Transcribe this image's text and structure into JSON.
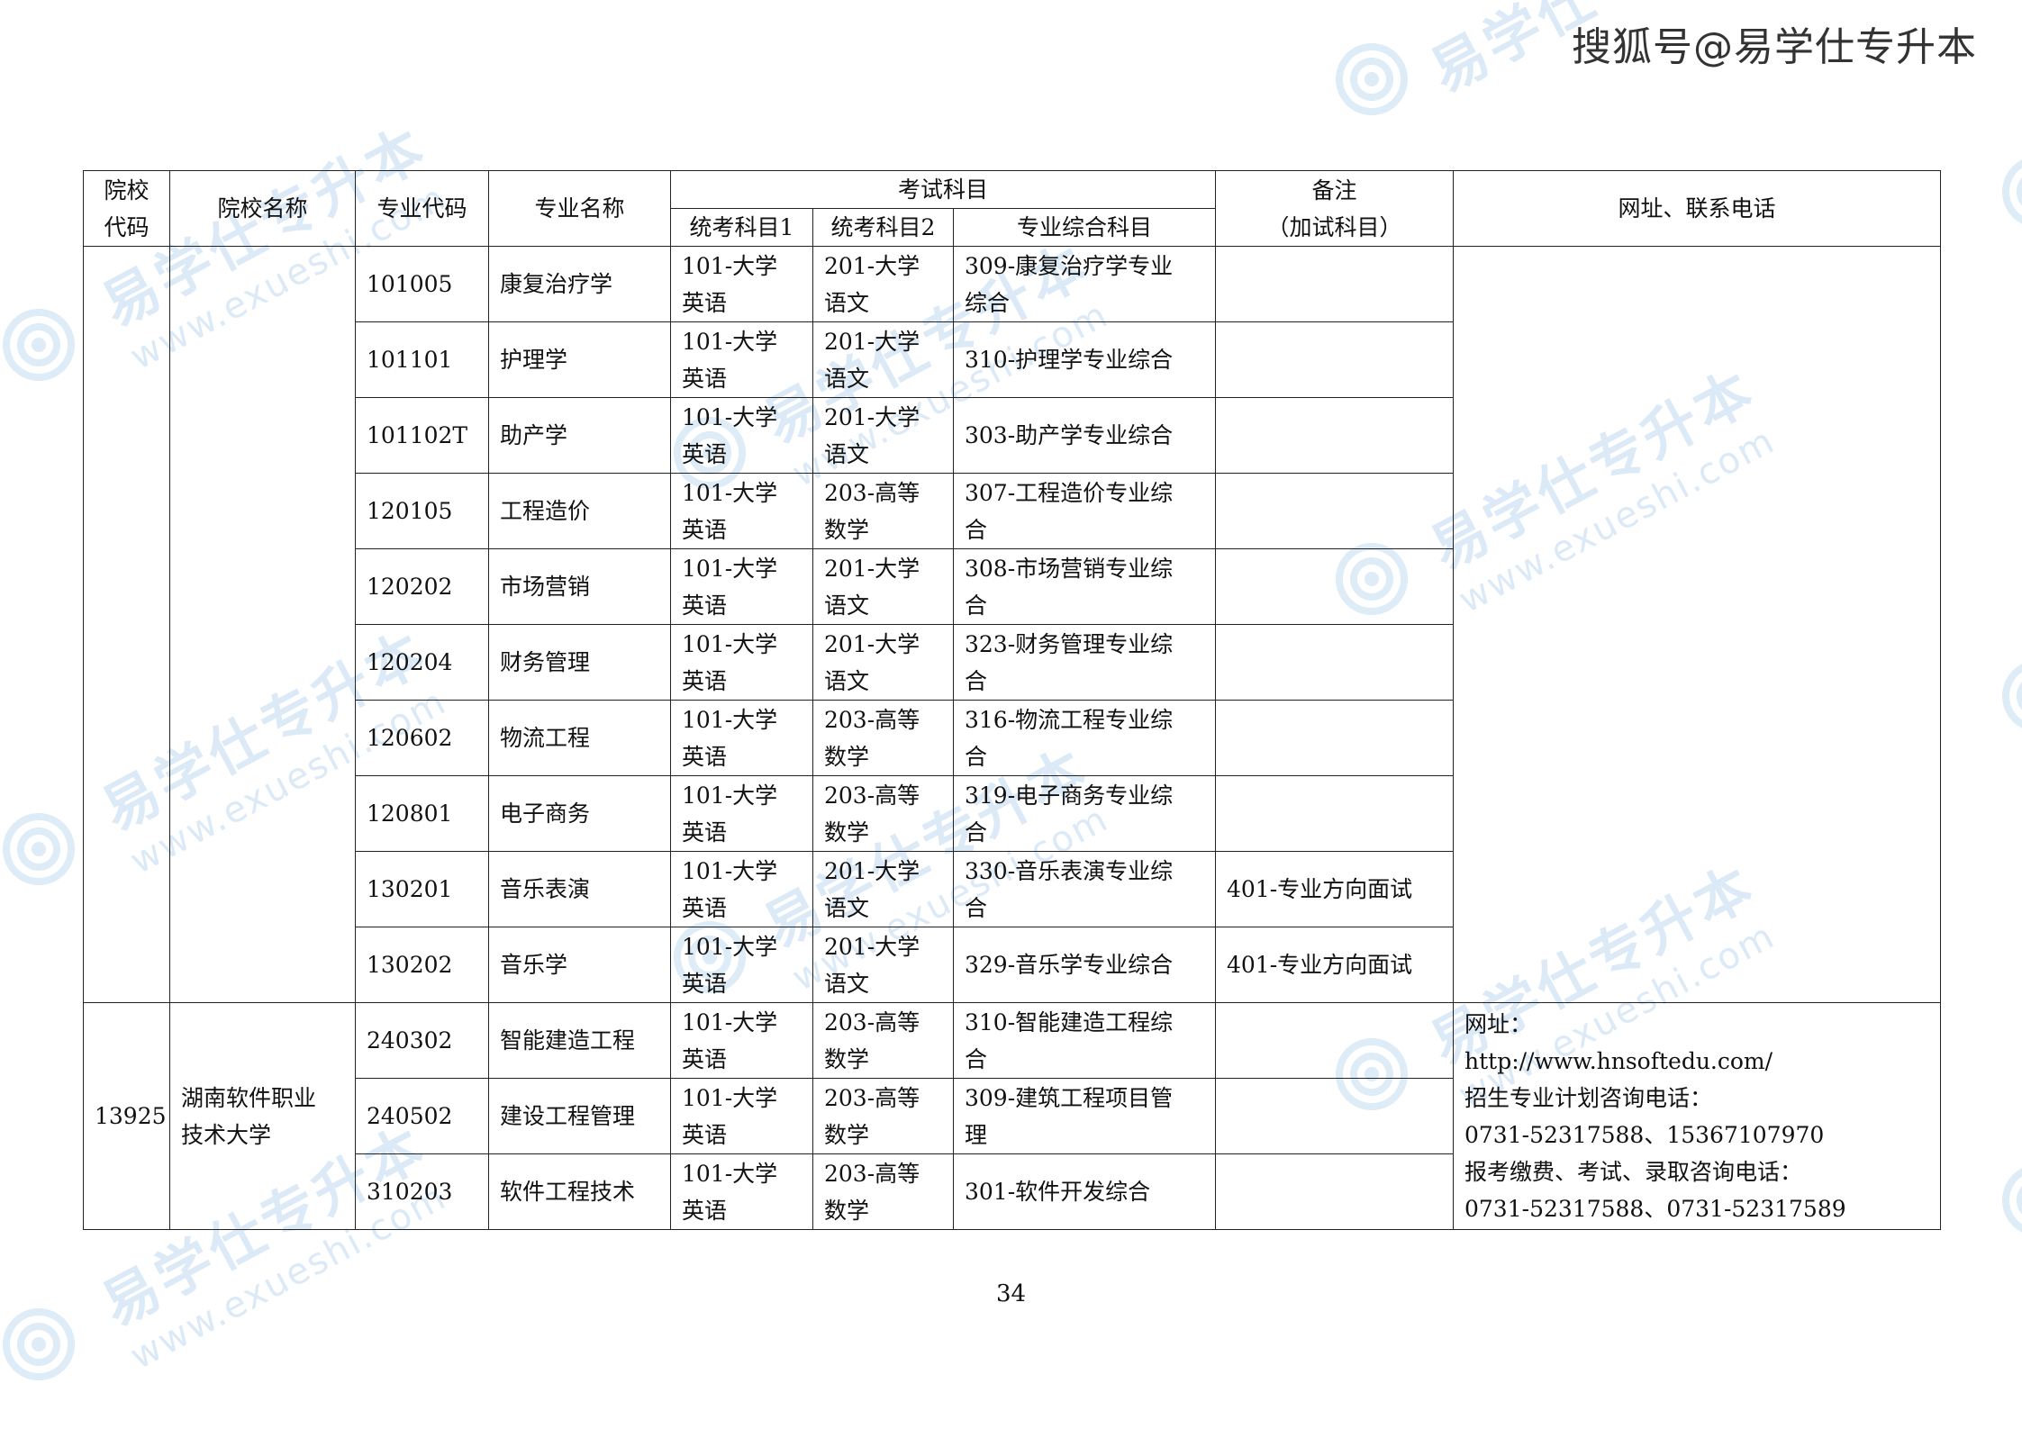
{
  "watermark": {
    "text": "易学仕专升本",
    "url": "www.exueshi.com"
  },
  "brand": "搜狐号@易学仕专升本",
  "headers": {
    "school_code": [
      "院校",
      "代码"
    ],
    "school_name": "院校名称",
    "major_code": "专业代码",
    "major_name": "专业名称",
    "exam_subjects": "考试科目",
    "subject1": "统考科目1",
    "subject2": "统考科目2",
    "comprehensive": "专业综合科目",
    "remark": [
      "备注",
      "（加试科目）"
    ],
    "contact": "网址、联系电话"
  },
  "group1": {
    "school_code": "",
    "school_name": "",
    "rows": [
      {
        "code": "101005",
        "name": "康复治疗学",
        "s1": [
          "101-大学",
          "英语"
        ],
        "s2": [
          "201-大学",
          "语文"
        ],
        "comp": [
          "309-康复治疗学专业",
          "综合"
        ],
        "remark": ""
      },
      {
        "code": "101101",
        "name": "护理学",
        "s1": [
          "101-大学",
          "英语"
        ],
        "s2": [
          "201-大学",
          "语文"
        ],
        "comp": [
          "310-护理学专业综合"
        ],
        "remark": ""
      },
      {
        "code": "101102T",
        "name": "助产学",
        "s1": [
          "101-大学",
          "英语"
        ],
        "s2": [
          "201-大学",
          "语文"
        ],
        "comp": [
          "303-助产学专业综合"
        ],
        "remark": ""
      },
      {
        "code": "120105",
        "name": "工程造价",
        "s1": [
          "101-大学",
          "英语"
        ],
        "s2": [
          "203-高等",
          "数学"
        ],
        "comp": [
          "307-工程造价专业综",
          "合"
        ],
        "remark": ""
      },
      {
        "code": "120202",
        "name": "市场营销",
        "s1": [
          "101-大学",
          "英语"
        ],
        "s2": [
          "201-大学",
          "语文"
        ],
        "comp": [
          "308-市场营销专业综",
          "合"
        ],
        "remark": ""
      },
      {
        "code": "120204",
        "name": "财务管理",
        "s1": [
          "101-大学",
          "英语"
        ],
        "s2": [
          "201-大学",
          "语文"
        ],
        "comp": [
          "323-财务管理专业综",
          "合"
        ],
        "remark": ""
      },
      {
        "code": "120602",
        "name": "物流工程",
        "s1": [
          "101-大学",
          "英语"
        ],
        "s2": [
          "203-高等",
          "数学"
        ],
        "comp": [
          "316-物流工程专业综",
          "合"
        ],
        "remark": ""
      },
      {
        "code": "120801",
        "name": "电子商务",
        "s1": [
          "101-大学",
          "英语"
        ],
        "s2": [
          "203-高等",
          "数学"
        ],
        "comp": [
          "319-电子商务专业综",
          "合"
        ],
        "remark": ""
      },
      {
        "code": "130201",
        "name": "音乐表演",
        "s1": [
          "101-大学",
          "英语"
        ],
        "s2": [
          "201-大学",
          "语文"
        ],
        "comp": [
          "330-音乐表演专业综",
          "合"
        ],
        "remark": "401-专业方向面试"
      },
      {
        "code": "130202",
        "name": "音乐学",
        "s1": [
          "101-大学",
          "英语"
        ],
        "s2": [
          "201-大学",
          "语文"
        ],
        "comp": [
          "329-音乐学专业综合"
        ],
        "remark": "401-专业方向面试"
      }
    ]
  },
  "group2": {
    "school_code": "13925",
    "school_name": [
      "湖南软件职业",
      "技术大学"
    ],
    "rows": [
      {
        "code": "240302",
        "name": "智能建造工程",
        "s1": [
          "101-大学",
          "英语"
        ],
        "s2": [
          "203-高等",
          "数学"
        ],
        "comp": [
          "310-智能建造工程综",
          "合"
        ],
        "remark": ""
      },
      {
        "code": "240502",
        "name": "建设工程管理",
        "s1": [
          "101-大学",
          "英语"
        ],
        "s2": [
          "203-高等",
          "数学"
        ],
        "comp": [
          "309-建筑工程项目管",
          "理"
        ],
        "remark": ""
      },
      {
        "code": "310203",
        "name": "软件工程技术",
        "s1": [
          "101-大学",
          "英语"
        ],
        "s2": [
          "203-高等",
          "数学"
        ],
        "comp": [
          "301-软件开发综合"
        ],
        "remark": ""
      }
    ],
    "contact": [
      "网址：",
      "http://www.hnsoftedu.com/",
      "招生专业计划咨询电话：",
      "0731-52317588、15367107970",
      "报考缴费、考试、录取咨询电话：",
      "0731-52317588、0731-52317589"
    ]
  },
  "page_number": "34"
}
